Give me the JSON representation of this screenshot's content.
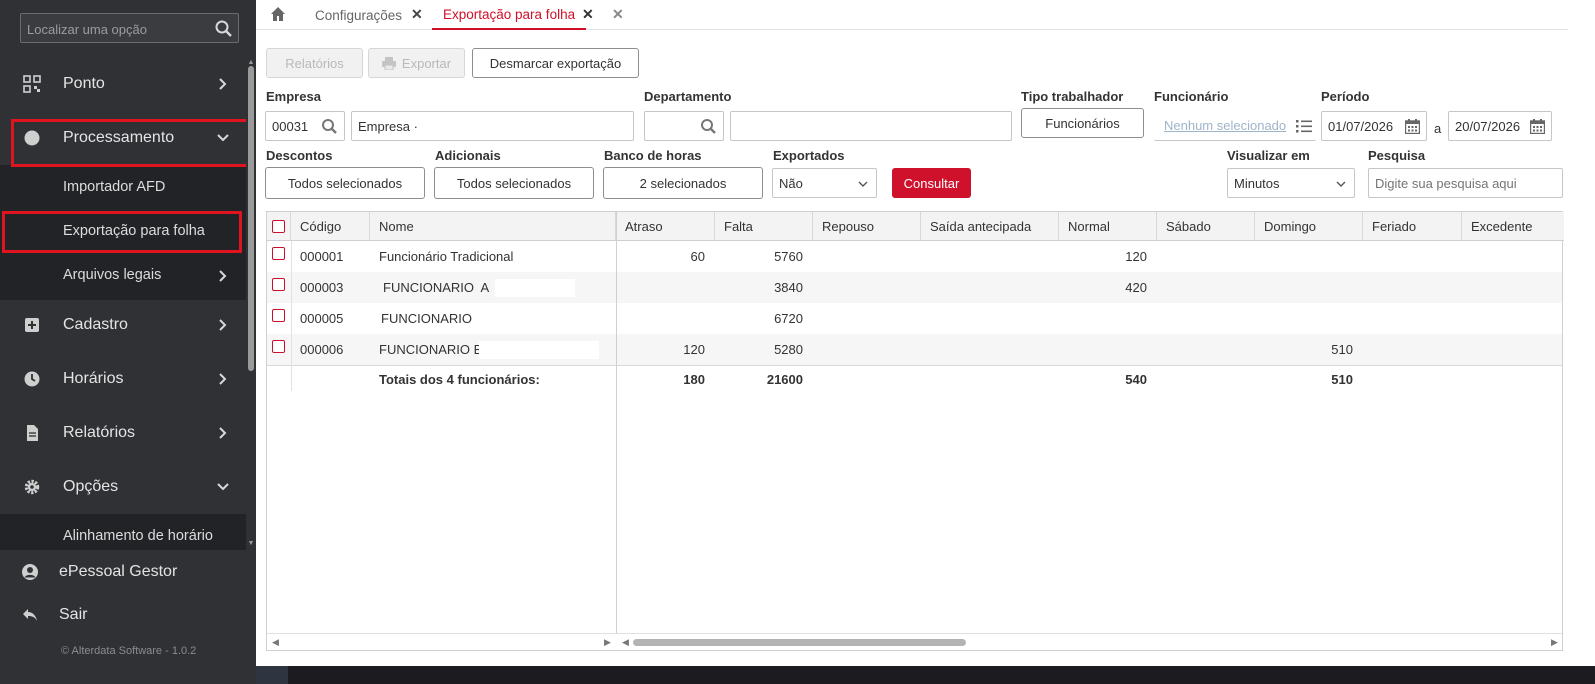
{
  "sidebar": {
    "search_placeholder": "Localizar uma opção",
    "items": [
      {
        "label": "Ponto",
        "icon": "qr-grid-icon"
      },
      {
        "label": "Processamento",
        "icon": "circle-icon"
      },
      {
        "label": "Cadastro",
        "icon": "plus-square-icon"
      },
      {
        "label": "Horários",
        "icon": "clock-icon"
      },
      {
        "label": "Relatórios",
        "icon": "document-icon"
      },
      {
        "label": "Opções",
        "icon": "gear-icon"
      }
    ],
    "subitems": [
      "Importador AFD",
      "Exportação para folha",
      "Arquivos legais"
    ],
    "subitem_opcoes": "Alinhamento de horário",
    "bottom": [
      {
        "label": "ePessoal Gestor",
        "icon": "user-circle-icon"
      },
      {
        "label": "Sair",
        "icon": "logout-arrow-icon"
      }
    ],
    "copyright": "© Alterdata Software - 1.0.2"
  },
  "tabs": [
    {
      "label": "Configurações",
      "active": false
    },
    {
      "label": "Exportação para folha",
      "active": true
    }
  ],
  "toolbar": {
    "relatorios": "Relatórios",
    "exportar": "Exportar",
    "desmarcar": "Desmarcar exportação"
  },
  "filters": {
    "empresa_label": "Empresa",
    "empresa_code": "00031",
    "empresa_name": "Empresa ·",
    "departamento_label": "Departamento",
    "tipo_label": "Tipo trabalhador",
    "tipo_value": "Funcionários",
    "funcionario_label": "Funcionário",
    "funcionario_placeholder": "Nenhum selecionado",
    "periodo_label": "Período",
    "periodo_start": "01/07/2026",
    "periodo_sep": "a",
    "periodo_end": "20/07/2026",
    "descontos_label": "Descontos",
    "descontos_value": "Todos selecionados",
    "adicionais_label": "Adicionais",
    "adicionais_value": "Todos selecionados",
    "banco_label": "Banco de horas",
    "banco_value": "2 selecionados",
    "exportados_label": "Exportados",
    "exportados_value": "Não",
    "consultar": "Consultar",
    "visualizar_label": "Visualizar em",
    "visualizar_value": "Minutos",
    "pesquisa_label": "Pesquisa",
    "pesquisa_placeholder": "Digite sua pesquisa aqui"
  },
  "table": {
    "columns": [
      "Código",
      "Nome",
      "Atraso",
      "Falta",
      "Repouso",
      "Saída antecipada",
      "Normal",
      "Sábado",
      "Domingo",
      "Feriado",
      "Excedente"
    ],
    "rows": [
      {
        "codigo": "000001",
        "nome": "Funcionário Tradicional",
        "atraso": "60",
        "falta": "5760",
        "normal": "120",
        "domingo": ""
      },
      {
        "codigo": "000003",
        "nome": "FUNCIONARIO  A",
        "atraso": "",
        "falta": "3840",
        "normal": "420",
        "domingo": ""
      },
      {
        "codigo": "000005",
        "nome": "FUNCIONARIO",
        "atraso": "",
        "falta": "6720",
        "normal": "",
        "domingo": ""
      },
      {
        "codigo": "000006",
        "nome": "FUNCIONARIO B",
        "atraso": "120",
        "falta": "5280",
        "normal": "",
        "domingo": "510"
      }
    ],
    "totals": {
      "label": "Totais dos 4 funcionários:",
      "atraso": "180",
      "falta": "21600",
      "normal": "540",
      "domingo": "510"
    }
  }
}
